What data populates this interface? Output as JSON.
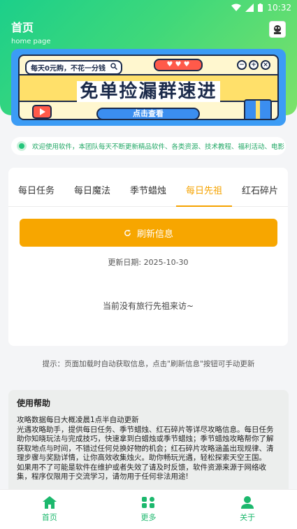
{
  "status_bar": {
    "time": "10:32"
  },
  "header": {
    "title": "首页",
    "subtitle": "home page"
  },
  "banner": {
    "pill_text": "每天0元购，不花一分钱",
    "hearts": "♥ ♥ ♥",
    "dots": [
      "−",
      "+",
      "×"
    ],
    "title": "免单捡漏群速进",
    "button_label": "点击查看"
  },
  "notice": {
    "text": "欢迎使用软件，本团队每天不断更新精品软件、各类资源、技术教程、福利活动、电影"
  },
  "tabs": [
    {
      "label": "每日任务"
    },
    {
      "label": "每日魔法"
    },
    {
      "label": "季节蜡烛"
    },
    {
      "label": "每日先祖",
      "active": true
    },
    {
      "label": "红石碎片"
    }
  ],
  "refresh_button": {
    "label": "刷新信息"
  },
  "update_date": "更新日期: 2025-10-30",
  "empty_message": "当前没有旅行先祖来访~",
  "hint": "提示：页面加载时自动获取信息，点击\"刷新信息\"按钮可手动更新",
  "help": {
    "title": "使用帮助",
    "lines": [
      "攻略数据每日大概凌晨1点半自动更新",
      "光遇攻略助手，提供每日任务、季节蜡烛、红石碎片等详尽攻略信息。每日任务助你知晓玩法与完成技巧，快速拿到白蜡烛或季节蜡烛；季节蜡烛攻略帮你了解获取地点与时间，不错过任何兑换好物的机会；红石碎片攻略涵盖出现规律、清理步骤与奖励详情，让你高效收集烛火。助你畅玩光遇，轻松探索天空王国。",
      "如果用不了可能是软件在维护或者失效了请及时反馈，软件资源来源于网络收集，程序仅限用于交流学习，请勿用于任何非法用途!"
    ]
  },
  "bottom_nav": [
    {
      "label": "首页",
      "icon": "home-icon"
    },
    {
      "label": "更多",
      "icon": "more-icon"
    },
    {
      "label": "关于",
      "icon": "user-icon"
    }
  ],
  "colors": {
    "accent": "#f7a600",
    "brand_green": "#1cb86d"
  }
}
